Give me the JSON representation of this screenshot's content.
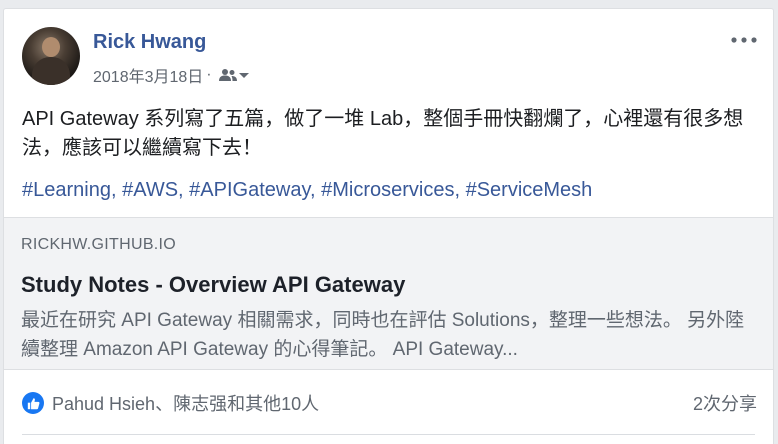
{
  "post": {
    "author": "Rick Hwang",
    "date": "2018年3月18日",
    "separator": "·",
    "text": "API Gateway 系列寫了五篇，做了一堆 Lab，整個手冊快翻爛了，心裡還有很多想法，應該可以繼續寫下去！",
    "tags": [
      {
        "label": "#Learning",
        "sep": ", "
      },
      {
        "label": "#AWS",
        "sep": ", "
      },
      {
        "label": "#APIGateway",
        "sep": ", "
      },
      {
        "label": "#Microservices",
        "sep": ", "
      },
      {
        "label": "#ServiceMesh",
        "sep": ""
      }
    ]
  },
  "link": {
    "domain": "RICKHW.GITHUB.IO",
    "title": "Study Notes - Overview API Gateway",
    "description": "最近在研究 API Gateway 相關需求，同時也在評估 Solutions，整理一些想法。 另外陸續整理 Amazon API Gateway 的心得筆記。 API Gateway..."
  },
  "footer": {
    "reactions_text": "Pahud Hsieh、陳志强和其他10人",
    "shares_text": "2次分享"
  },
  "icons": {
    "audience": "friends-icon",
    "more": "more-options-icon",
    "like": "like-icon"
  },
  "colors": {
    "link_blue": "#385898",
    "like_blue": "#1877f2",
    "muted": "#606770"
  }
}
